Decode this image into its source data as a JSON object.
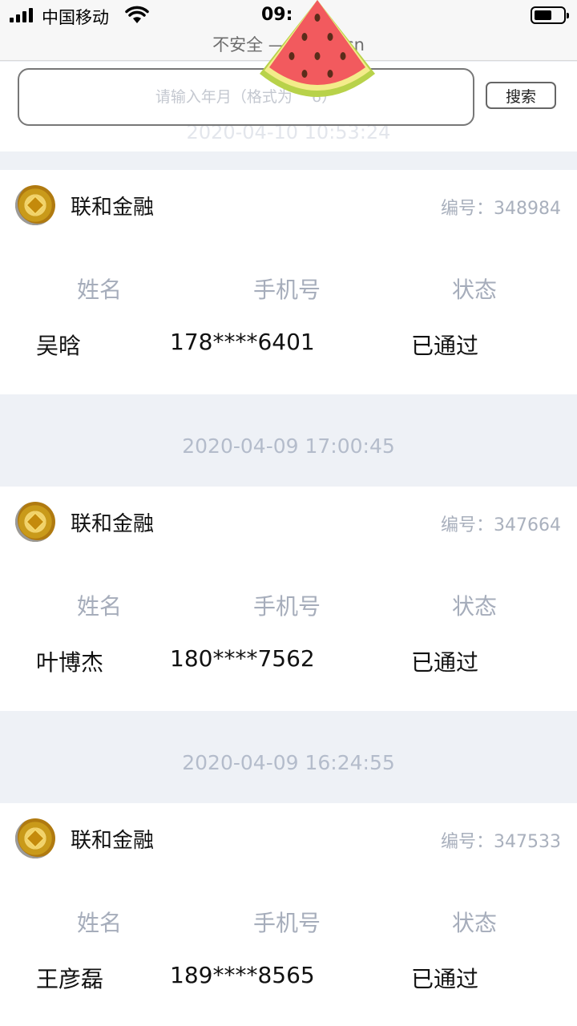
{
  "status_bar": {
    "carrier": "中国移动",
    "time": "09:",
    "icons": [
      "signal-icon",
      "wifi-icon",
      "battery-icon"
    ]
  },
  "browser": {
    "url_display": "不安全 — zd        my.cn"
  },
  "search": {
    "placeholder": "请输入年月（格式为    6）",
    "button_label": "搜索"
  },
  "records": [
    {
      "date": "2020-04-10 10:53:24",
      "company": "联和金融",
      "serial": "编号：348984",
      "headers": [
        "姓名",
        "手机号",
        "状态"
      ],
      "name": "吴晗",
      "phone": "178****6401",
      "status": "已通过"
    },
    {
      "date": "2020-04-09 17:00:45",
      "company": "联和金融",
      "serial": "编号：347664",
      "headers": [
        "姓名",
        "手机号",
        "状态"
      ],
      "name": "叶博杰",
      "phone": "180****7562",
      "status": "已通过"
    },
    {
      "date": "2020-04-09 16:24:55",
      "company": "联和金融",
      "serial": "编号：347533",
      "headers": [
        "姓名",
        "手机号",
        "状态"
      ],
      "name": "王彦磊",
      "phone": "189****8565",
      "status": "已通过"
    }
  ],
  "colors": {
    "page_bg": "#eef1f6",
    "card_bg": "#ffffff",
    "muted_text": "#a6adbb",
    "date_text": "#b4bccb"
  }
}
